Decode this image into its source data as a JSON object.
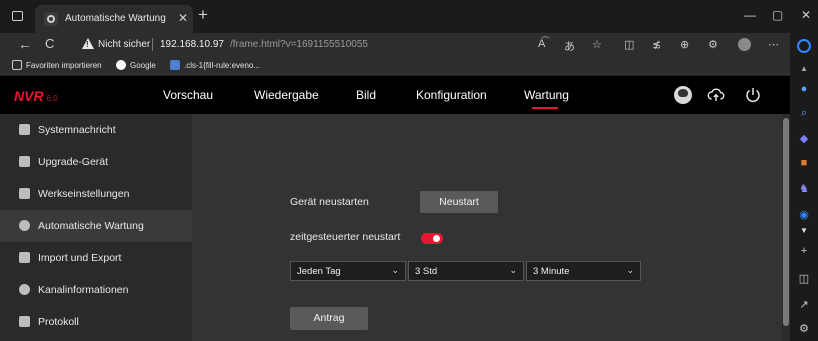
{
  "browser": {
    "tab": {
      "title": "Automatische Wartung",
      "close_glyph": "✕"
    },
    "new_tab_glyph": "+",
    "window_controls": {
      "minimize": "—",
      "maximize": "▢",
      "close": "✕"
    },
    "toolbar": {
      "back": "←",
      "reload": "C",
      "security_label": "Nicht sicher",
      "host": "192.168.10.97",
      "path": "/frame.html?v=1691155510055",
      "icons": [
        "read-aloud-icon",
        "translate-icon",
        "favorite-star-icon",
        "split-screen-icon",
        "favorites-icon",
        "collections-icon",
        "extensions-icon",
        "profile-icon",
        "more-icon"
      ]
    },
    "favorites": {
      "import_label": "Favoriten importieren",
      "google_label": "Google",
      "cls_label": ".cls-1{fill-rule:eveno..."
    },
    "edge_sidebar": [
      "copilot-icon",
      "notification-icon",
      "search-icon",
      "tag-icon",
      "toolbox-icon",
      "games-icon",
      "outlook-icon",
      "more-icon",
      "add-icon",
      "sidebar-toggle-icon",
      "external-icon",
      "settings-icon"
    ]
  },
  "app": {
    "logo": "NVR",
    "logo_version": "6.0",
    "accent_color": "#e8162e",
    "menu": [
      "Vorschau",
      "Wiedergabe",
      "Bild",
      "Konfiguration",
      "Wartung"
    ],
    "active_menu": "Wartung",
    "header_icons": [
      "user-avatar-icon",
      "cloud-upload-icon",
      "power-icon"
    ],
    "sidebar": [
      {
        "label": "Systemnachricht",
        "icon": "system-message-icon"
      },
      {
        "label": "Upgrade-Gerät",
        "icon": "upgrade-icon"
      },
      {
        "label": "Werkseinstellungen",
        "icon": "factory-reset-icon"
      },
      {
        "label": "Automatische Wartung",
        "icon": "auto-maintenance-icon",
        "active": true
      },
      {
        "label": "Import und Export",
        "icon": "import-export-icon"
      },
      {
        "label": "Kanalinformationen",
        "icon": "channel-info-icon"
      },
      {
        "label": "Protokoll",
        "icon": "log-icon"
      }
    ],
    "form": {
      "restart_label": "Gerät neustarten",
      "restart_button": "Neustart",
      "timed_restart_label": "zeitgesteuerter neustart",
      "timed_restart_enabled": true,
      "day_select": "Jeden Tag",
      "hour_select": "3 Std",
      "minute_select": "3 Minute",
      "apply_button": "Antrag"
    }
  }
}
